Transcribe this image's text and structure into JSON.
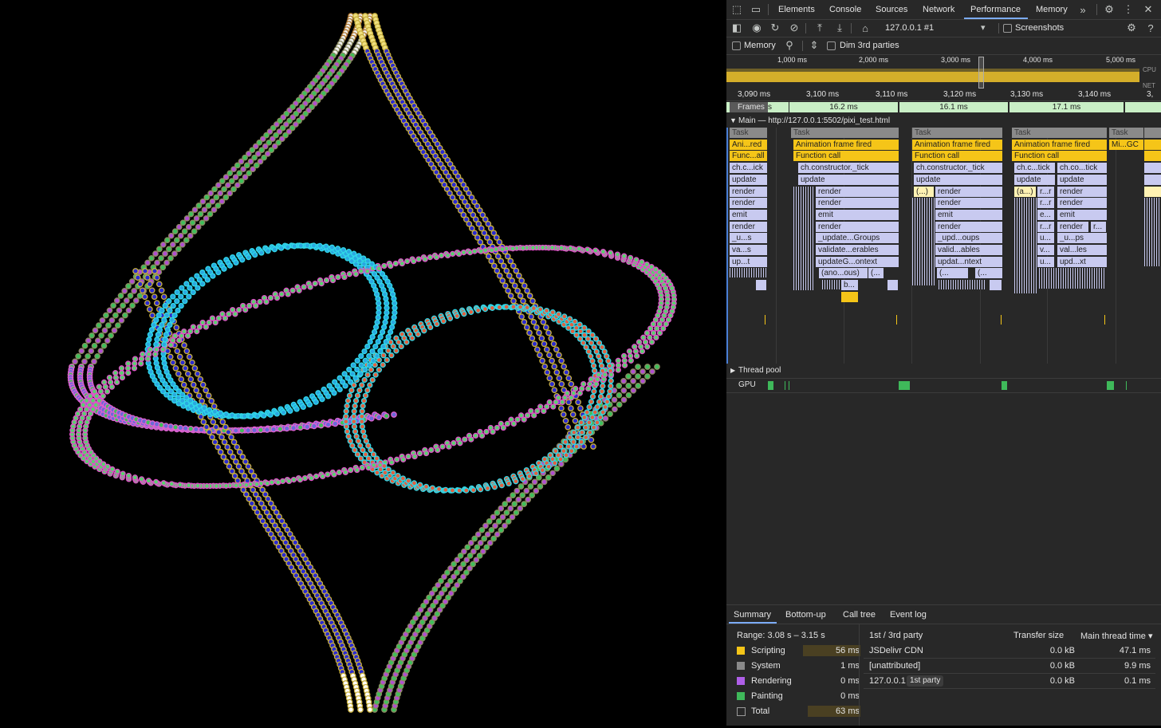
{
  "devtools": {
    "tabs": [
      "Elements",
      "Console",
      "Sources",
      "Network",
      "Performance",
      "Memory"
    ],
    "active_tab": "Performance",
    "toolbar": {
      "target": "127.0.0.1 #1",
      "screenshots_label": "Screenshots",
      "memory_label": "Memory",
      "dim_label": "Dim 3rd parties"
    },
    "overview": {
      "ticks": [
        "1,000 ms",
        "2,000 ms",
        "3,000 ms",
        "4,000 ms",
        "5,000 ms"
      ],
      "cpu_label": "CPU",
      "net_label": "NET"
    },
    "ruler": [
      "3,090 ms",
      "3,100 ms",
      "3,110 ms",
      "3,120 ms",
      "3,130 ms",
      "3,140 ms",
      "3,"
    ],
    "frames": {
      "label": "Frames",
      "suffix": "s",
      "values": [
        "16.2 ms",
        "16.1 ms",
        "17.1 ms"
      ]
    },
    "main_thread": {
      "title": "Main — http://127.0.0.1:5502/pixi_test.html",
      "col1": [
        "Task",
        "Ani...red",
        "Func...all",
        "ch.c...ick",
        "update",
        "render",
        "render",
        "emit",
        "render",
        "_u...s",
        "va...s",
        "up...t"
      ],
      "col2": [
        "Task",
        "Animation frame fired",
        "Function call",
        "ch.constructor._tick",
        "update",
        "render",
        "render",
        "emit",
        "render",
        "_update...Groups",
        "validate...erables",
        "updateG...ontext",
        "(ano...ous)",
        "(...",
        "b..."
      ],
      "col2_small": "(...",
      "col3": [
        "Task",
        "Animation frame fired",
        "Function call",
        "ch.constructor._tick",
        "update",
        "render",
        "render",
        "emit",
        "render",
        "_upd...oups",
        "valid...ables",
        "updat...ntext",
        "(...",
        "(..."
      ],
      "col3_small": "(...)",
      "col4": [
        "Task",
        "Animation frame fired",
        "Function call",
        "ch.c...tick",
        "update",
        "render",
        "render",
        "e...",
        "r...r",
        "u...",
        "v...",
        "(a...)",
        "r...r",
        "r..."
      ],
      "col5": [
        "Task",
        "Mi...GC",
        "ch.co...tick",
        "update",
        "render",
        "render",
        "emit",
        "render",
        "_u...ps",
        "val...les",
        "upd...xt"
      ],
      "thread_pool": "Thread pool",
      "gpu": "GPU"
    },
    "bottom_tabs": [
      "Summary",
      "Bottom-up",
      "Call tree",
      "Event log"
    ],
    "summary": {
      "range": "Range: 3.08 s – 3.15 s",
      "rows": [
        {
          "name": "Scripting",
          "value": "56 ms",
          "color": "#f5c518"
        },
        {
          "name": "System",
          "value": "1 ms",
          "color": "#8a8a8a"
        },
        {
          "name": "Rendering",
          "value": "0 ms",
          "color": "#af5fe8"
        },
        {
          "name": "Painting",
          "value": "0 ms",
          "color": "#3fb95a"
        },
        {
          "name": "Total",
          "value": "63 ms",
          "color": "#282828"
        }
      ],
      "table_headers": [
        "1st / 3rd party",
        "Transfer size",
        "Main thread time ▾"
      ],
      "table_rows": [
        {
          "name": "JSDelivr CDN",
          "badge": "",
          "size": "0.0 kB",
          "time": "47.1 ms"
        },
        {
          "name": "[unattributed]",
          "badge": "",
          "size": "0.0 kB",
          "time": "9.9 ms"
        },
        {
          "name": "127.0.0.1",
          "badge": "1st party",
          "size": "0.0 kB",
          "time": "0.1 ms"
        }
      ]
    }
  }
}
